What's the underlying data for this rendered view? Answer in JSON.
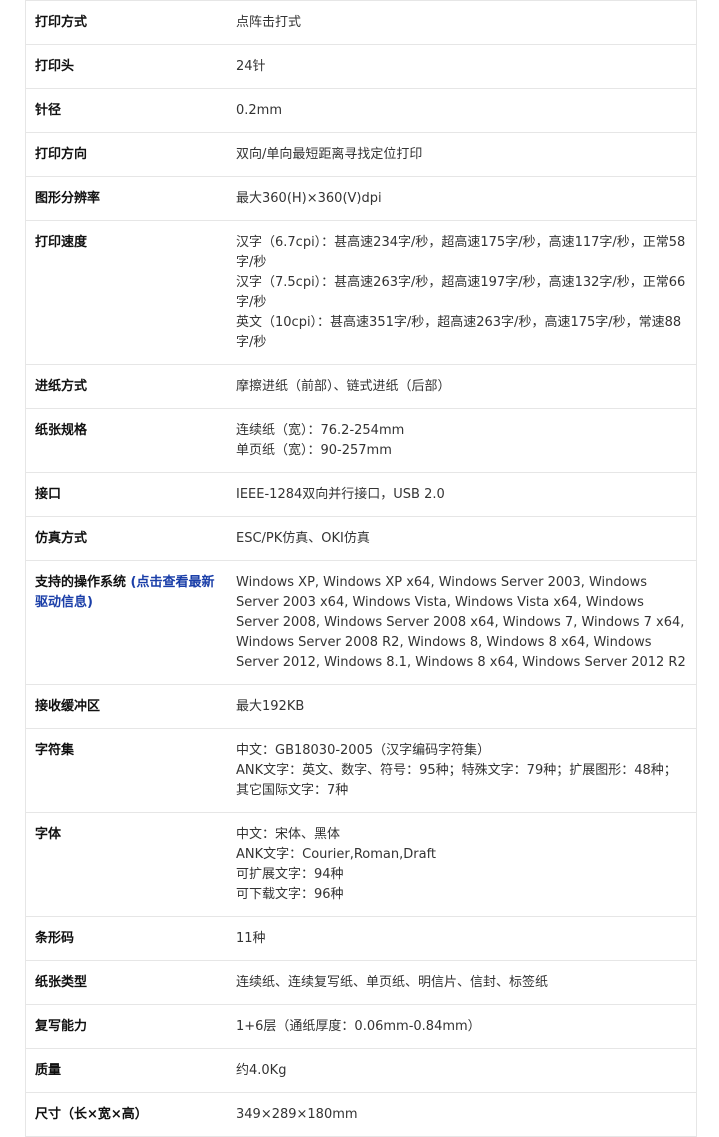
{
  "specs": [
    {
      "label": "打印方式",
      "lines": [
        "点阵击打式"
      ]
    },
    {
      "label": "打印头",
      "lines": [
        "24针"
      ]
    },
    {
      "label": "针径",
      "lines": [
        "0.2mm"
      ]
    },
    {
      "label": "打印方向",
      "lines": [
        "双向/单向最短距离寻找定位打印"
      ]
    },
    {
      "label": "图形分辨率",
      "lines": [
        "最大360(H)×360(V)dpi"
      ]
    },
    {
      "label": "打印速度",
      "lines": [
        "汉字（6.7cpi）：甚高速234字/秒，超高速175字/秒，高速117字/秒，正常58字/秒",
        "汉字（7.5cpi）：甚高速263字/秒，超高速197字/秒，高速132字/秒，正常66字/秒",
        "英文（10cpi）：甚高速351字/秒，超高速263字/秒，高速175字/秒，常速88字/秒"
      ]
    },
    {
      "label": "进纸方式",
      "lines": [
        "摩擦进纸（前部）、链式进纸（后部）"
      ]
    },
    {
      "label": "纸张规格",
      "lines": [
        "连续纸（宽）：76.2-254mm",
        "单页纸（宽）：90-257mm"
      ]
    },
    {
      "label": "接口",
      "lines": [
        "IEEE-1284双向并行接口，USB 2.0"
      ]
    },
    {
      "label": "仿真方式",
      "lines": [
        "ESC/PK仿真、OKI仿真"
      ]
    },
    {
      "label": "支持的操作系统",
      "link": "(点击查看最新驱动信息)",
      "lines": [
        "Windows XP, Windows XP x64, Windows Server 2003, Windows Server 2003 x64, Windows Vista, Windows Vista x64, Windows Server 2008, Windows Server 2008 x64, Windows 7, Windows 7 x64, Windows Server 2008 R2, Windows 8, Windows 8 x64, Windows Server 2012, Windows 8.1, Windows 8 x64, Windows Server 2012 R2"
      ]
    },
    {
      "label": "接收缓冲区",
      "lines": [
        "最大192KB"
      ]
    },
    {
      "label": "字符集",
      "lines": [
        "中文：GB18030-2005（汉字编码字符集）",
        "ANK文字：英文、数字、符号：95种；特殊文字：79种；扩展图形：48种；其它国际文字：7种"
      ]
    },
    {
      "label": "字体",
      "lines": [
        "中文：宋体、黑体",
        "ANK文字：Courier,Roman,Draft",
        "可扩展文字：94种",
        "可下载文字：96种"
      ]
    },
    {
      "label": "条形码",
      "lines": [
        "11种"
      ]
    },
    {
      "label": "纸张类型",
      "lines": [
        "连续纸、连续复写纸、单页纸、明信片、信封、标签纸"
      ]
    },
    {
      "label": "复写能力",
      "lines": [
        "1+6层（通纸厚度：0.06mm-0.84mm）"
      ]
    },
    {
      "label": "质量",
      "lines": [
        "约4.0Kg"
      ]
    },
    {
      "label": "尺寸（长×宽×高）",
      "lines": [
        "349×289×180mm"
      ]
    }
  ],
  "colors": {
    "label": "#111111",
    "value": "#333333",
    "link": "#1a3ea8",
    "border": "#e6e6e6"
  }
}
